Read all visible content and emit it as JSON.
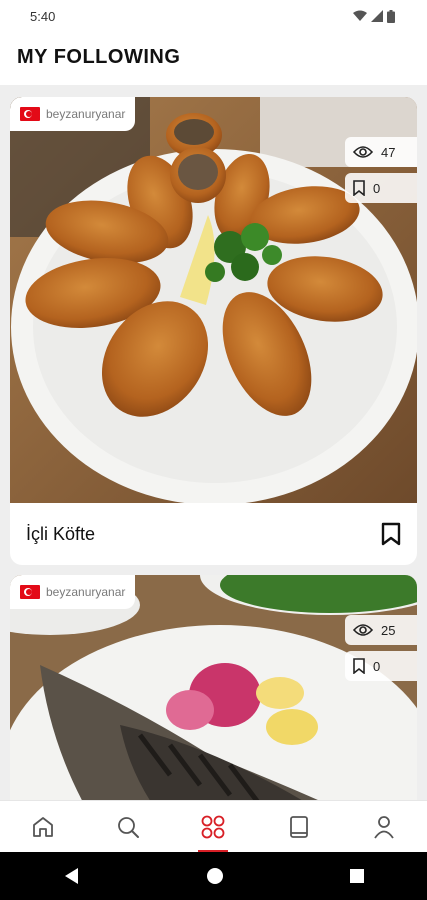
{
  "status_bar": {
    "time": "5:40"
  },
  "header": {
    "title": "MY FOLLOWING"
  },
  "posts": [
    {
      "author": "beyzanuryanar",
      "views": "47",
      "saves": "0",
      "title": "İçli Köfte"
    },
    {
      "author": "beyzanuryanar",
      "views": "25",
      "saves": "0",
      "title": ""
    }
  ],
  "bottom_nav": {
    "items": [
      {
        "icon": "home-icon",
        "active": false
      },
      {
        "icon": "search-icon",
        "active": false
      },
      {
        "icon": "following-icon",
        "active": true
      },
      {
        "icon": "book-icon",
        "active": false
      },
      {
        "icon": "profile-icon",
        "active": false
      }
    ]
  },
  "colors": {
    "accent": "#d81f26",
    "flag": "#e30a17",
    "feed_background": "#eeeeee"
  }
}
